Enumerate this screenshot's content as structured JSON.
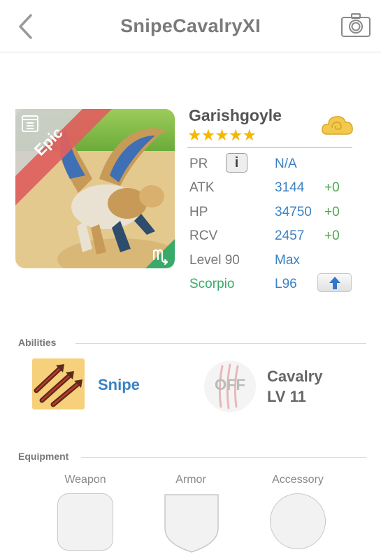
{
  "header": {
    "title": "SnipeCavalryXI",
    "back_icon": "chevron-left-icon",
    "camera_icon": "camera-icon"
  },
  "monster": {
    "name": "Garishgoyle",
    "rarity_tag": "Epic",
    "stars": "★★★★★",
    "star_count": 5,
    "element_icon": "cloud-icon",
    "sign_icon": "scorpio-sign-icon",
    "book_icon": "book-icon",
    "stats": {
      "pr": {
        "label": "PR",
        "value": "N/A",
        "info_icon": "info-icon",
        "info_text": "i"
      },
      "atk": {
        "label": "ATK",
        "value": "3144",
        "bonus": "+0"
      },
      "hp": {
        "label": "HP",
        "value": "34750",
        "bonus": "+0"
      },
      "rcv": {
        "label": "RCV",
        "value": "2457",
        "bonus": "+0"
      },
      "level": {
        "label": "Level 90",
        "value": "Max"
      },
      "sign": {
        "label": "Scorpio",
        "value": "L96",
        "upgrade_icon": "up-arrow-icon"
      }
    }
  },
  "abilities": {
    "title": "Abilities",
    "ability": {
      "name": "Snipe",
      "icon": "snipe-arrows-icon"
    },
    "skill": {
      "state": "OFF",
      "name": "Cavalry",
      "level": "LV 11",
      "icon": "claw-marks-icon"
    }
  },
  "equipment": {
    "title": "Equipment",
    "slots": [
      {
        "label": "Weapon"
      },
      {
        "label": "Armor"
      },
      {
        "label": "Accessory"
      }
    ]
  },
  "colors": {
    "accent_blue": "#3a82c5",
    "bonus_green": "#4aa84a",
    "sign_green": "#3aaa6a",
    "star_gold": "#f5b800",
    "epic_red": "#e06060"
  }
}
